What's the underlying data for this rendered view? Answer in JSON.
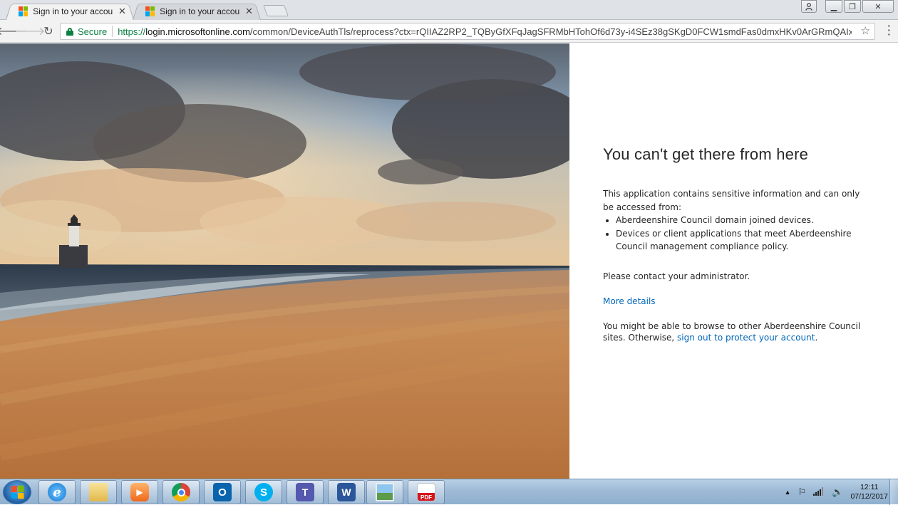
{
  "browser": {
    "tabs": [
      {
        "title": "Sign in to your account",
        "active": true
      },
      {
        "title": "Sign in to your account",
        "active": false
      }
    ],
    "security_label": "Secure",
    "url_scheme": "https://",
    "url_host": "login.microsoftonline.com",
    "url_path": "/common/DeviceAuthTls/reprocess?ctx=rQIIAZ2RP2_TQByGfXFqJagSFRMbHTohOf6d73y-i4SEz38gSKgD0FCW1smdFas0dmxHKv0ArGRmQAIxZWR..."
  },
  "page": {
    "heading": "You can't get there from here",
    "intro": "This application contains sensitive information and can only be accessed from:",
    "requirements": [
      "Aberdeenshire Council domain joined devices.",
      "Devices or client applications that meet Aberdeenshire Council management compliance policy."
    ],
    "contact": "Please contact your administrator.",
    "more_details": "More details",
    "browse_text": "You might be able to browse to other Aberdeenshire Council sites. Otherwise, ",
    "sign_out_link": "sign out to protect your account",
    "browse_end": "."
  },
  "taskbar": {
    "apps": [
      "internet-explorer",
      "file-explorer",
      "media-player",
      "chrome",
      "outlook",
      "skype",
      "teams",
      "word",
      "photo-viewer",
      "pdf-reader"
    ],
    "clock_time": "12:11",
    "clock_date": "07/12/2017"
  },
  "colors": {
    "link": "#0067b8",
    "secure": "#0b8043",
    "ms_red": "#f25022",
    "ms_green": "#7fba00",
    "ms_blue": "#00a4ef",
    "ms_yellow": "#ffb900"
  }
}
